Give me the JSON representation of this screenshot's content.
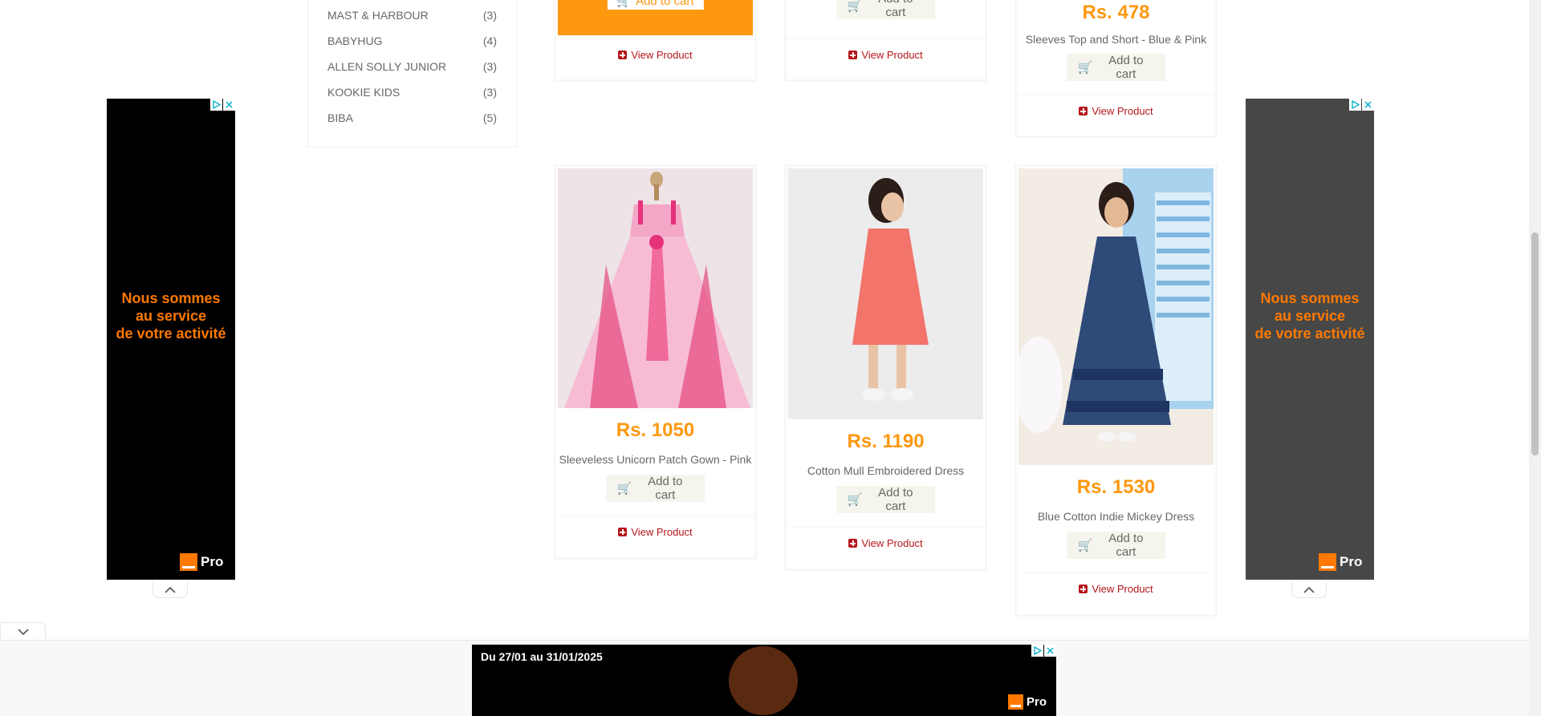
{
  "brands": [
    {
      "name": "MAST & HARBOUR",
      "count": "(3)"
    },
    {
      "name": "BABYHUG",
      "count": "(4)"
    },
    {
      "name": "ALLEN SOLLY JUNIOR",
      "count": "(3)"
    },
    {
      "name": "KOOKIE KIDS",
      "count": "(3)"
    },
    {
      "name": "BIBA",
      "count": "(5)"
    }
  ],
  "labels": {
    "add_to_cart": "Add to cart",
    "view_product": "View Product"
  },
  "top_cards": [
    {
      "price": "",
      "name": ""
    },
    {
      "price": "",
      "name": ""
    },
    {
      "price": "Rs. 478",
      "name": "Sleeves Top and Short - Blue & Pink"
    }
  ],
  "products": [
    {
      "price": "Rs. 1050",
      "name": "Sleeveless Unicorn Patch Gown - Pink"
    },
    {
      "price": "Rs. 1190",
      "name": "Cotton Mull Embroidered Dress"
    },
    {
      "price": "Rs. 1530",
      "name": "Blue Cotton Indie Mickey Dress"
    }
  ],
  "ads": {
    "side_text": [
      "Nous sommes",
      "au service",
      "de votre activité"
    ],
    "pro_label": "Pro",
    "bottom_date": "Du 27/01 au 31/01/2025"
  },
  "colors": {
    "price": "#fe980f",
    "view_link": "#b4161b",
    "ad_orange": "#ff7900",
    "add_to_cart_bg": "#f5f5ed"
  }
}
